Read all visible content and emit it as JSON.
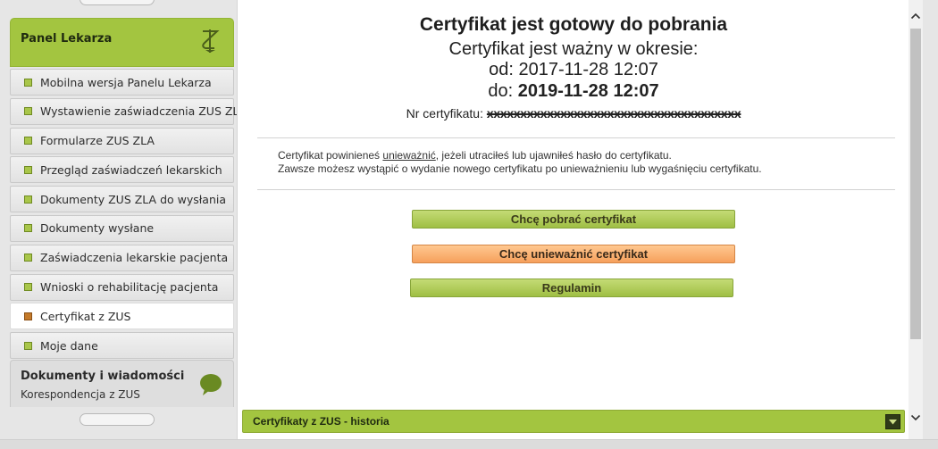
{
  "sidebar": {
    "panel_title": "Panel Lekarza",
    "menu": [
      {
        "label": "Mobilna wersja Panelu Lekarza",
        "active": false
      },
      {
        "label": "Wystawienie zaświadczenia ZUS ZLA",
        "active": false
      },
      {
        "label": "Formularze ZUS ZLA",
        "active": false
      },
      {
        "label": "Przegląd zaświadczeń lekarskich",
        "active": false
      },
      {
        "label": "Dokumenty ZUS ZLA do wysłania",
        "active": false
      },
      {
        "label": "Dokumenty wysłane",
        "active": false
      },
      {
        "label": "Zaświadczenia lekarskie pacjenta",
        "active": false
      },
      {
        "label": "Wnioski o rehabilitację pacjenta",
        "active": false
      },
      {
        "label": "Certyfikat z ZUS",
        "active": true
      },
      {
        "label": "Moje dane",
        "active": false
      }
    ],
    "docs_title": "Dokumenty i wiadomości",
    "docs_subtitle": "Korespondencja z ZUS"
  },
  "main": {
    "heading": "Certyfikat jest gotowy do pobrania",
    "validity_label": "Certyfikat jest ważny w okresie:",
    "from_label": "od:",
    "from_value": "2017-11-28 12:07",
    "to_label": "do:",
    "to_value": "2019-11-28 12:07",
    "nr_label": "Nr certyfikatu:",
    "nr_value": "xxxxxxxxxxxxxxxxxxxxxxxxxxxxxxxxxxxxxx",
    "info_before_link": "Certyfikat powinieneś ",
    "info_link": "unieważnić",
    "info_after_link": ", jeżeli utraciłeś lub ujawniłeś hasło do certyfikatu.",
    "info_line2": "Zawsze możesz wystąpić o wydanie nowego certyfikatu po unieważnieniu lub wygaśnięciu certyfikatu.",
    "buttons": {
      "download": "Chcę pobrać certyfikat",
      "revoke": "Chcę unieważnić certyfikat",
      "rules": "Regulamin"
    },
    "history_label": "Certyfikaty z ZUS - historia"
  },
  "colors": {
    "accent_green": "#a3c540",
    "button_orange": "#f6a05c",
    "active_bullet": "#c47a2a"
  },
  "icons": {
    "panel": "caduceus-icon",
    "docs": "speech-bubble-icon",
    "history_toggle": "chevron-down-icon",
    "scroll_up": "chevron-up-icon",
    "scroll_down": "chevron-down-icon"
  }
}
